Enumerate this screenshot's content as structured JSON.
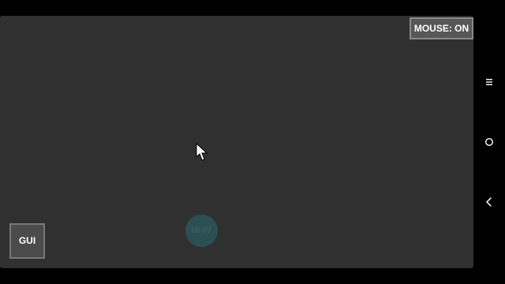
{
  "overlay": {
    "mouse_toggle_label": "MOUSE: ON",
    "gui_button_label": "GUI",
    "clock_text": "06:07"
  },
  "colors": {
    "background": "#303030",
    "mouse_toggle_bg": "#575757",
    "gui_button_bg": "#4b4b4b",
    "clock_bubble_bg": "#2c4f51"
  },
  "navbar": {
    "icons": [
      "menu-icon",
      "home-icon",
      "back-icon"
    ]
  }
}
